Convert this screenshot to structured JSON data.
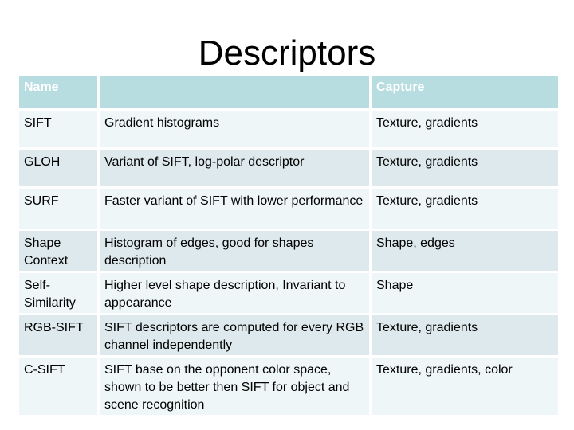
{
  "title": "Descriptors",
  "table": {
    "headers": [
      "Name",
      "",
      "Capture"
    ],
    "rows": [
      {
        "name": "SIFT",
        "description": "Gradient histograms",
        "capture": "Texture, gradients"
      },
      {
        "name": "GLOH",
        "description": "Variant of SIFT, log-polar descriptor",
        "capture": "Texture, gradients"
      },
      {
        "name": "SURF",
        "description": "Faster variant of SIFT with lower performance",
        "capture": "Texture, gradients"
      },
      {
        "name": "Shape Context",
        "description": "Histogram of edges, good for shapes description",
        "capture": "Shape, edges"
      },
      {
        "name": "Self-Similarity",
        "description": "Higher level shape description, Invariant to appearance",
        "capture": "Shape"
      },
      {
        "name": "RGB-SIFT",
        "description": "SIFT descriptors are computed for every RGB channel independently",
        "capture": "Texture, gradients"
      },
      {
        "name": "C-SIFT",
        "description": "SIFT base on the opponent color space, shown to be better then SIFT for object and scene recognition",
        "capture": "Texture, gradients, color"
      }
    ]
  }
}
